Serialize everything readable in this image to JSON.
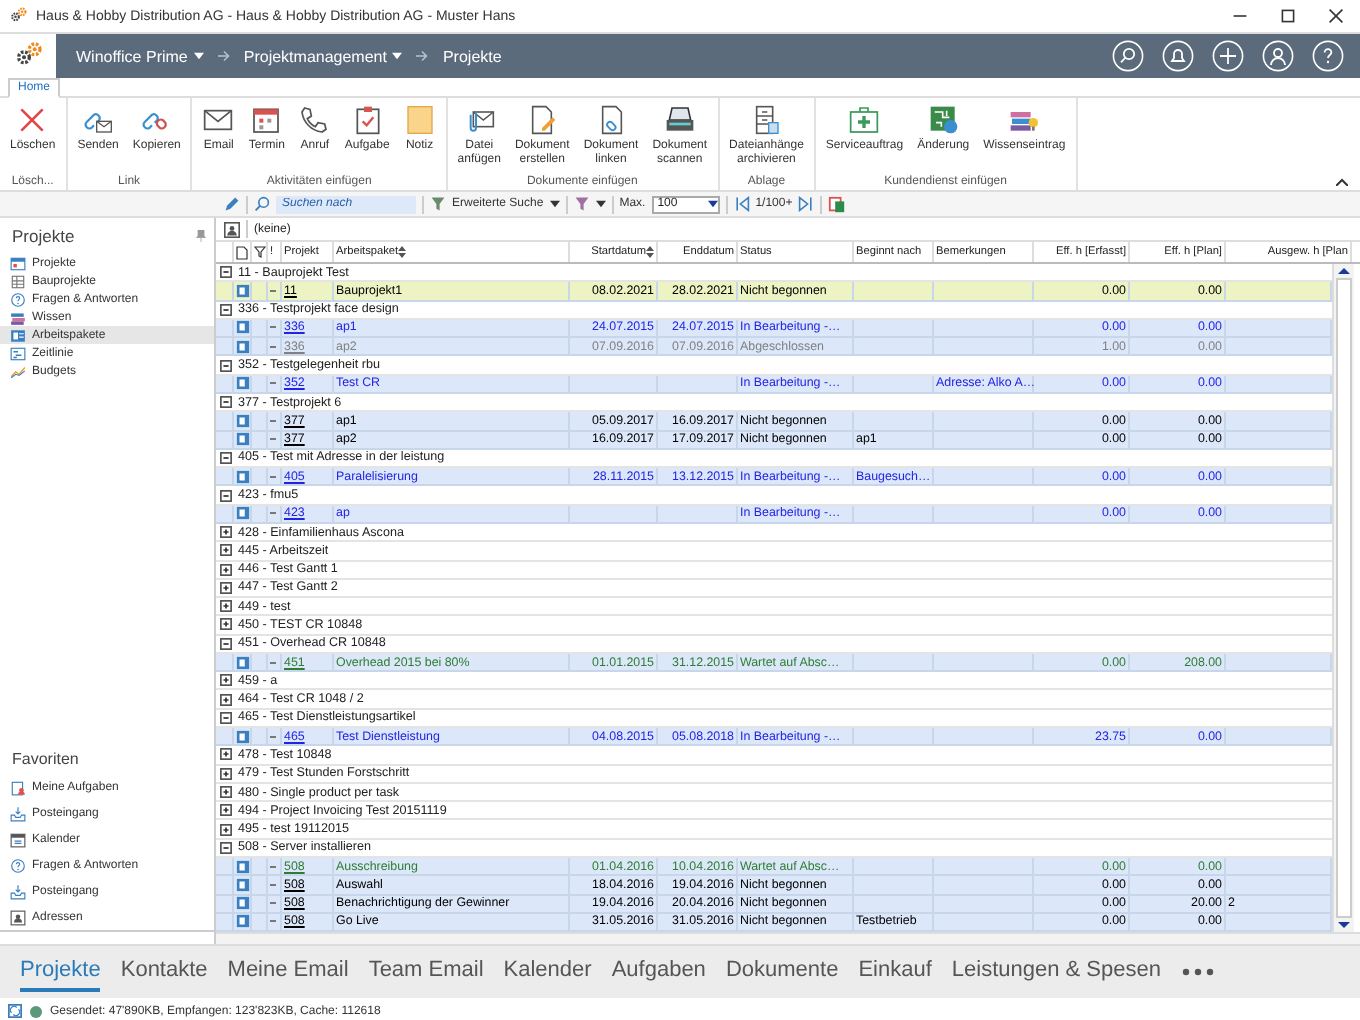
{
  "window": {
    "title": "Haus & Hobby Distribution AG - Haus & Hobby Distribution AG - Muster Hans"
  },
  "nav": {
    "breadcrumbs": [
      {
        "label": "Winoffice Prime",
        "dropdown": true
      },
      {
        "label": "Projektmanagement",
        "dropdown": true
      },
      {
        "label": "Projekte",
        "dropdown": false
      }
    ]
  },
  "ribbon_tabs": [
    {
      "label": "Home",
      "selected": true
    }
  ],
  "ribbon_groups": [
    {
      "label": "Lösch...",
      "buttons": [
        "Löschen"
      ]
    },
    {
      "label": "Link",
      "buttons": [
        "Senden",
        "Kopieren"
      ]
    },
    {
      "label": "Aktivitäten einfügen",
      "buttons": [
        "Email",
        "Termin",
        "Anruf",
        "Aufgabe",
        "Notiz"
      ]
    },
    {
      "label": "Dokumente einfügen",
      "buttons": [
        "Datei anfügen",
        "Dokument erstellen",
        "Dokument linken",
        "Dokument scannen"
      ]
    },
    {
      "label": "Ablage",
      "buttons": [
        "Dateianhänge archivieren"
      ]
    },
    {
      "label": "Kundendienst einfügen",
      "buttons": [
        "Serviceauftrag",
        "Änderung",
        "Wissenseintrag"
      ]
    }
  ],
  "toolbar": {
    "search_placeholder": "Suchen nach",
    "advanced_search": "Erweiterte Suche",
    "max_label": "Max.",
    "max_value": "100",
    "paging": "1/100+"
  },
  "filter": {
    "value": "(keine)"
  },
  "sidebar": {
    "title": "Projekte",
    "items": [
      {
        "label": "Projekte",
        "selected": false
      },
      {
        "label": "Bauprojekte",
        "selected": false
      },
      {
        "label": "Fragen & Antworten",
        "selected": false
      },
      {
        "label": "Wissen",
        "selected": false
      },
      {
        "label": "Arbeitspakete",
        "selected": true
      },
      {
        "label": "Zeitlinie",
        "selected": false
      },
      {
        "label": "Budgets",
        "selected": false
      }
    ],
    "favorites_title": "Favoriten",
    "favorites": [
      "Meine Aufgaben",
      "Posteingang",
      "Kalender",
      "Fragen & Antworten",
      "Posteingang",
      "Adressen"
    ]
  },
  "table": {
    "columns": [
      "!",
      "Projekt",
      "Arbeitspaket",
      "Startdatum",
      "Enddatum",
      "Status",
      "Beginnt nach",
      "Bemerkungen",
      "Eff. h [Erfasst]",
      "Eff. h [Plan]",
      "Ausgew. h [Plan"
    ],
    "groups": [
      {
        "label": "11  -  Bauprojekt Test",
        "expanded": true,
        "rows": [
          {
            "projekt": "11",
            "arbeitspaket": "Bauprojekt1",
            "startdatum": "08.02.2021",
            "enddatum": "28.02.2021",
            "status": "Nicht begonnen",
            "eff_erfasst": "0.00",
            "eff_plan": "0.00",
            "selected": true,
            "color": "#000000"
          }
        ]
      },
      {
        "label": "336  -  Testprojekt face design",
        "expanded": true,
        "rows": [
          {
            "projekt": "336",
            "arbeitspaket": "ap1",
            "startdatum": "24.07.2015",
            "enddatum": "24.07.2015",
            "status": "In Bearbeitung -…",
            "eff_erfasst": "0.00",
            "eff_plan": "0.00",
            "selected": false,
            "color": "#2323e6"
          },
          {
            "projekt": "336",
            "arbeitspaket": "ap2",
            "startdatum": "07.09.2016",
            "enddatum": "07.09.2016",
            "status": "Abgeschlossen",
            "eff_erfasst": "1.00",
            "eff_plan": "0.00",
            "selected": false,
            "color": "#808080"
          }
        ]
      },
      {
        "label": "352  -  Testgelegenheit rbu",
        "expanded": true,
        "rows": [
          {
            "projekt": "352",
            "arbeitspaket": "Test CR",
            "status": "In Bearbeitung -…",
            "bemerkungen": "Adresse: Alko A…",
            "eff_erfasst": "0.00",
            "eff_plan": "0.00",
            "selected": false,
            "color": "#2323e6"
          }
        ]
      },
      {
        "label": "377  -  Testprojekt 6",
        "expanded": true,
        "rows": [
          {
            "projekt": "377",
            "arbeitspaket": "ap1",
            "startdatum": "05.09.2017",
            "enddatum": "16.09.2017",
            "status": "Nicht begonnen",
            "eff_erfasst": "0.00",
            "eff_plan": "0.00",
            "selected": false,
            "color": "#000000"
          },
          {
            "projekt": "377",
            "arbeitspaket": "ap2",
            "startdatum": "16.09.2017",
            "enddatum": "17.09.2017",
            "status": "Nicht begonnen",
            "beginnt_nach": "ap1",
            "eff_erfasst": "0.00",
            "eff_plan": "0.00",
            "selected": false,
            "color": "#000000"
          }
        ]
      },
      {
        "label": "405  -  Test mit Adresse in der leistung",
        "expanded": true,
        "rows": [
          {
            "projekt": "405",
            "arbeitspaket": "Paralelisierung",
            "startdatum": "28.11.2015",
            "enddatum": "13.12.2015",
            "status": "In Bearbeitung -…",
            "beginnt_nach": "Baugesuch…",
            "eff_erfasst": "0.00",
            "eff_plan": "0.00",
            "selected": false,
            "color": "#2323e6"
          }
        ]
      },
      {
        "label": "423  -  fmu5",
        "expanded": true,
        "rows": [
          {
            "projekt": "423",
            "arbeitspaket": "ap",
            "status": "In Bearbeitung -…",
            "eff_erfasst": "0.00",
            "eff_plan": "0.00",
            "selected": false,
            "color": "#2323e6"
          }
        ]
      },
      {
        "label": "428  -  Einfamilienhaus Ascona",
        "expanded": false
      },
      {
        "label": "445  -  Arbeitszeit",
        "expanded": false
      },
      {
        "label": "446  -  Test Gantt 1",
        "expanded": false
      },
      {
        "label": "447  -  Test Gantt 2",
        "expanded": false
      },
      {
        "label": "449  -  test",
        "expanded": false
      },
      {
        "label": "450  -  TEST CR 10848",
        "expanded": false
      },
      {
        "label": "451  -  Overhead CR 10848",
        "expanded": true,
        "rows": [
          {
            "projekt": "451",
            "arbeitspaket": "Overhead 2015 bei 80%",
            "startdatum": "01.01.2015",
            "enddatum": "31.12.2015",
            "status": "Wartet auf Absc…",
            "eff_erfasst": "0.00",
            "eff_plan": "208.00",
            "selected": false,
            "color": "#2e7d32"
          }
        ]
      },
      {
        "label": "459  -  a",
        "expanded": false
      },
      {
        "label": "464  -  Test CR 1048 / 2",
        "expanded": false
      },
      {
        "label": "465  -  Test Dienstleistungsartikel",
        "expanded": true,
        "rows": [
          {
            "projekt": "465",
            "arbeitspaket": "Test Dienstleistung",
            "startdatum": "04.08.2015",
            "enddatum": "05.08.2018",
            "status": "In Bearbeitung -…",
            "eff_erfasst": "23.75",
            "eff_plan": "0.00",
            "selected": false,
            "color": "#2323e6"
          }
        ]
      },
      {
        "label": "478  -  Test 10848",
        "expanded": false
      },
      {
        "label": "479  -  Test Stunden Forstschritt",
        "expanded": false
      },
      {
        "label": "480  -  Single product per task",
        "expanded": false
      },
      {
        "label": "494  -  Project Invoicing Test 20151119",
        "expanded": false
      },
      {
        "label": "495  -  test 19112015",
        "expanded": false
      },
      {
        "label": "508  -  Server installieren",
        "expanded": true,
        "rows": [
          {
            "projekt": "508",
            "arbeitspaket": "Ausschreibung",
            "startdatum": "01.04.2016",
            "enddatum": "10.04.2016",
            "status": "Wartet auf Absc…",
            "eff_erfasst": "0.00",
            "eff_plan": "0.00",
            "selected": false,
            "color": "#2e7d32"
          },
          {
            "projekt": "508",
            "arbeitspaket": "Auswahl",
            "startdatum": "18.04.2016",
            "enddatum": "19.04.2016",
            "status": "Nicht begonnen",
            "eff_erfasst": "0.00",
            "eff_plan": "0.00",
            "selected": false,
            "color": "#000000"
          },
          {
            "projekt": "508",
            "arbeitspaket": "Benachrichtigung der Gewinner",
            "startdatum": "19.04.2016",
            "enddatum": "20.04.2016",
            "status": "Nicht begonnen",
            "eff_erfasst": "0.00",
            "eff_plan": "20.00",
            "ausgew_plan": "2",
            "selected": false,
            "color": "#000000"
          },
          {
            "projekt": "508",
            "arbeitspaket": "Go Live",
            "startdatum": "31.05.2016",
            "enddatum": "31.05.2016",
            "status": "Nicht begonnen",
            "beginnt_nach": "Testbetrieb",
            "eff_erfasst": "0.00",
            "eff_plan": "0.00",
            "selected": false,
            "color": "#000000"
          }
        ]
      }
    ]
  },
  "modules": [
    {
      "label": "Projekte",
      "selected": true
    },
    {
      "label": "Kontakte",
      "selected": false
    },
    {
      "label": "Meine Email",
      "selected": false
    },
    {
      "label": "Team Email",
      "selected": false
    },
    {
      "label": "Kalender",
      "selected": false
    },
    {
      "label": "Aufgaben",
      "selected": false
    },
    {
      "label": "Dokumente",
      "selected": false
    },
    {
      "label": "Einkauf",
      "selected": false
    },
    {
      "label": "Leistungen & Spesen",
      "selected": false
    }
  ],
  "status_bar": {
    "text": "Gesendet: 47'890KB, Empfangen: 123'823KB, Cache: 112618"
  }
}
